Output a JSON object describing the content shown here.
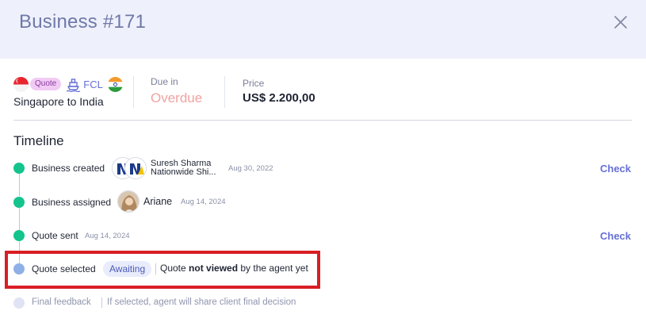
{
  "header": {
    "title": "Business #171"
  },
  "route": {
    "quote_badge": "Quote",
    "mode": "FCL",
    "text": "Singapore to India"
  },
  "due": {
    "label": "Due in",
    "value": "Overdue"
  },
  "price": {
    "label": "Price",
    "value": "US$ 2.200,00"
  },
  "timeline": {
    "title": "Timeline",
    "events": [
      {
        "label": "Business created",
        "person_name": "Suresh Sharma",
        "person_company": "Nationwide Shi...",
        "date": "Aug 30, 2022",
        "action": "Check"
      },
      {
        "label": "Business assigned",
        "person_name": "Ariane",
        "date": "Aug 14, 2024"
      },
      {
        "label": "Quote sent",
        "date": "Aug 14, 2024",
        "action": "Check"
      },
      {
        "label": "Quote selected",
        "status": "Awaiting",
        "msg_pre": "Quote ",
        "msg_bold": "not viewed",
        "msg_post": " by the agent yet"
      },
      {
        "label": "Final feedback",
        "desc": "If selected, agent will share client final decision"
      }
    ]
  },
  "colors": {
    "header_bg": "#eef0fb",
    "accent": "#6670d6",
    "done_dot": "#14c48c",
    "current_dot": "#8fb0e6",
    "overdue": "#f0a3a0",
    "highlight_box": "#d81e24"
  },
  "icons": [
    "close-icon",
    "singapore-flag-icon",
    "ship-icon",
    "india-flag-icon"
  ]
}
